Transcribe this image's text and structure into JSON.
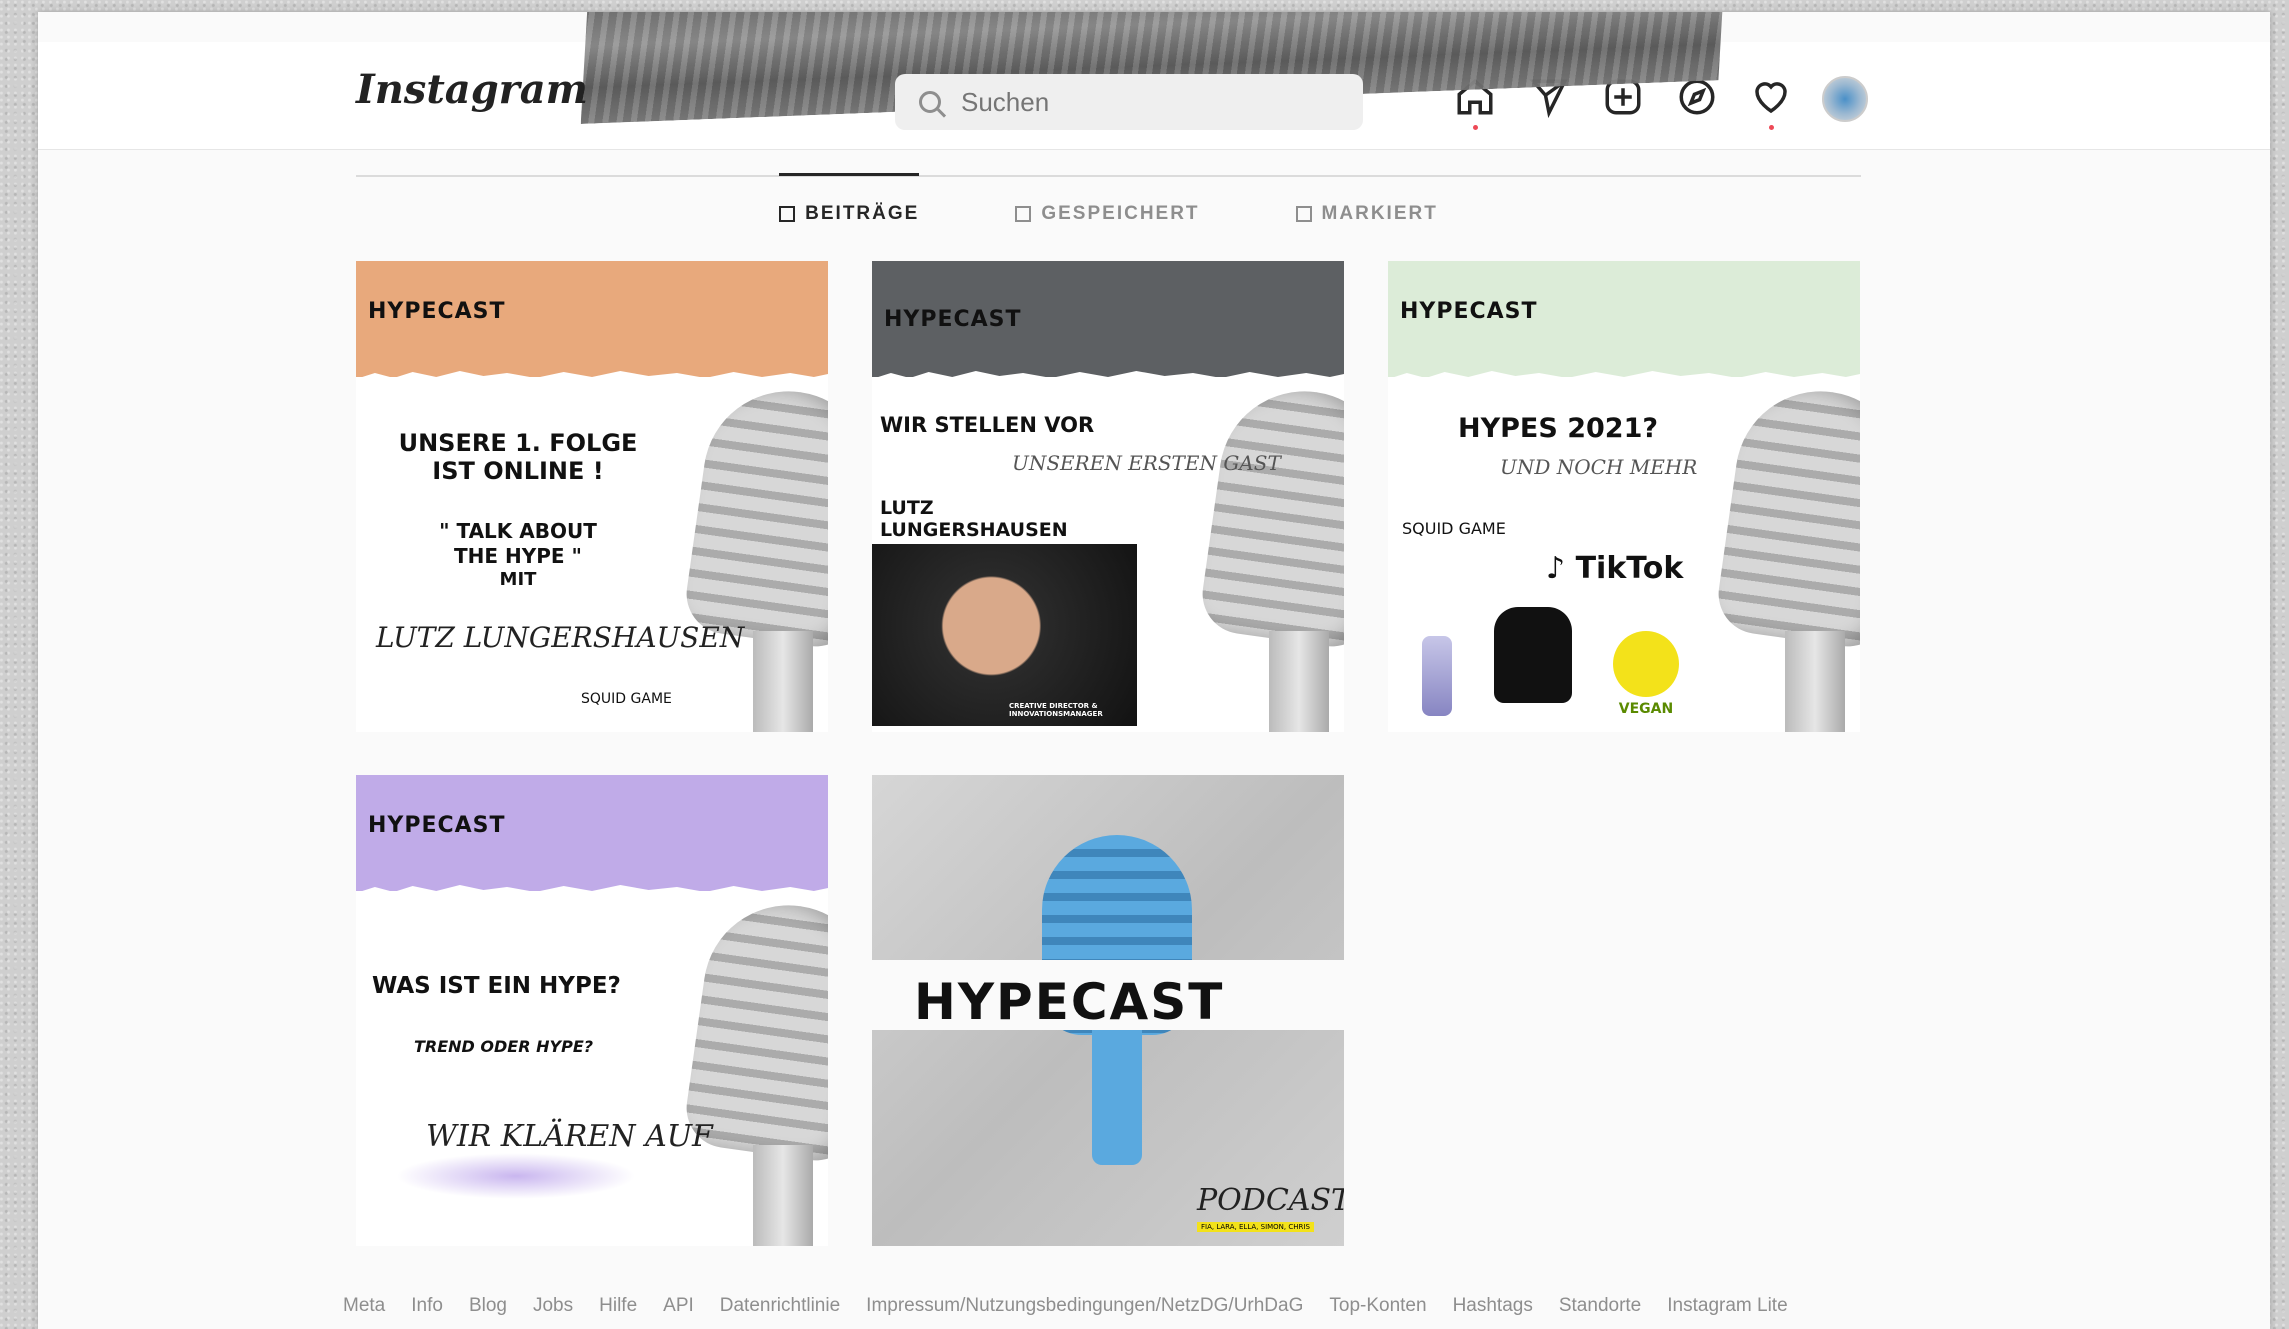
{
  "app": {
    "logo": "Instagram"
  },
  "search": {
    "placeholder": "Suchen"
  },
  "nav": {
    "items": [
      "home-icon",
      "direct-icon",
      "new-post-icon",
      "explore-icon",
      "activity-icon",
      "profile-avatar"
    ]
  },
  "tabs": [
    {
      "label": "BEITRÄGE",
      "active": true
    },
    {
      "label": "GESPEICHERT",
      "active": false
    },
    {
      "label": "MARKIERT",
      "active": false
    }
  ],
  "posts": [
    {
      "band_color": "#e8a97c",
      "brand": "HYPECAST",
      "line1": "UNSERE 1. FOLGE",
      "line2": "IST ONLINE !",
      "line3": "\" TALK ABOUT",
      "line4": "THE HYPE \"",
      "line5": "MIT",
      "script": "LUTZ LUNGERSHAUSEN",
      "badge": "SQUID GAME"
    },
    {
      "band_color": "#5d6063",
      "brand": "HYPECAST",
      "line1": "WIR STELLEN VOR",
      "script": "UNSEREN ERSTEN GAST",
      "line2": "LUTZ",
      "line3": "LUNGERSHAUSEN",
      "caption": "CREATIVE DIRECTOR & INNOVATIONSMANAGER"
    },
    {
      "band_color": "#dcecd8",
      "brand": "HYPECAST",
      "line1": "HYPES 2021?",
      "script": "UND NOCH MEHR",
      "badge": "SQUID GAME",
      "tiktok": "TikTok",
      "vegan": "VEGAN"
    },
    {
      "band_color": "#c0abe8",
      "brand": "HYPECAST",
      "line1": "WAS IST EIN HYPE?",
      "line2": "TREND ODER HYPE?",
      "script": "WIR KLÄREN AUF"
    },
    {
      "brand": "HYPECAST",
      "script": "PODCAST",
      "caption": "FIA, LARA, ELLA, SIMON, CHRIS"
    }
  ],
  "footer": [
    "Meta",
    "Info",
    "Blog",
    "Jobs",
    "Hilfe",
    "API",
    "Datenrichtlinie",
    "Impressum/Nutzungsbedingungen/NetzDG/UrhDaG",
    "Top-Konten",
    "Hashtags",
    "Standorte",
    "Instagram Lite"
  ],
  "colors": {
    "notification_dot": "#ed4956",
    "tab_active": "#262626",
    "muted": "#8e8e8e"
  }
}
